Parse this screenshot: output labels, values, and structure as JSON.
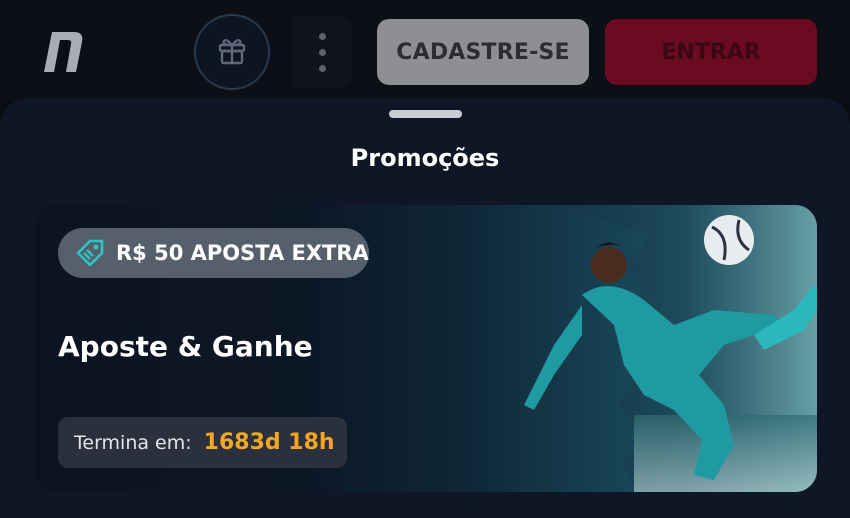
{
  "header": {
    "logo_icon": "brand-logo-n",
    "gift_icon": "gift-icon",
    "more_icon": "more-vertical-icon",
    "signup_label": "CADASTRE-SE",
    "login_label": "ENTRAR"
  },
  "sheet": {
    "title": "Promoções"
  },
  "promo": {
    "badge_icon": "tag-icon",
    "badge_text": "R$ 50 APOSTA EXTRA",
    "title": "Aposte & Ganhe",
    "ends_label": "Termina em:",
    "ends_value": "1683d 18h"
  },
  "colors": {
    "accent_orange": "#f5a623",
    "login_red": "#6b0b22",
    "badge_gray": "#56606c"
  }
}
